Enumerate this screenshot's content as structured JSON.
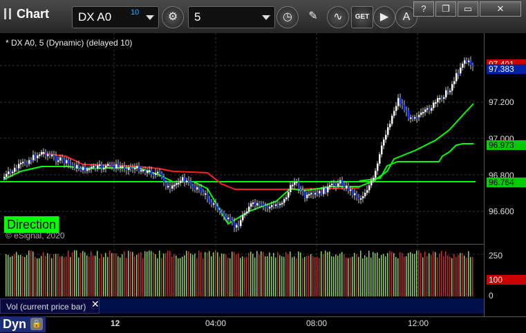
{
  "header": {
    "title": "Chart",
    "symbol": "DX A0",
    "delay_badge": "10",
    "interval": "5",
    "window_buttons": [
      "?",
      "❐",
      "▭",
      "✕"
    ]
  },
  "study": {
    "title": "* DX A0, 5 (Dynamic) (delayed 10)",
    "direction_label": "Direction",
    "copyright": "© eSignal, 2020"
  },
  "price_axis": {
    "labels": [
      "97.200",
      "97.000",
      "96.800",
      "96.600"
    ],
    "tags": [
      {
        "value": "97.401",
        "bg": "#cc0000",
        "fg": "#ffffff"
      },
      {
        "value": "97.383",
        "bg": "#0022aa",
        "fg": "#ffffff"
      },
      {
        "value": "96.973",
        "bg": "#00cc00",
        "fg": "#000000"
      },
      {
        "value": "96.764",
        "bg": "#00cc00",
        "fg": "#000000"
      }
    ]
  },
  "volume": {
    "panel_label": "Vol (current price bar)",
    "close_glyph": "✕",
    "axis_labels": [
      "250",
      "0"
    ],
    "tag": "100"
  },
  "time_axis": {
    "labels": [
      "12",
      "04:00",
      "08:00",
      "12:00"
    ],
    "mode_label": "Dyn",
    "lock_glyph": "🔒"
  },
  "colors": {
    "up_bar": "#ffffff",
    "down_bar": "#1a3cff",
    "trail_red": "#ff2020",
    "trail_green": "#00ff00",
    "vol_up": "#8fd068",
    "vol_down": "#c03030"
  }
}
